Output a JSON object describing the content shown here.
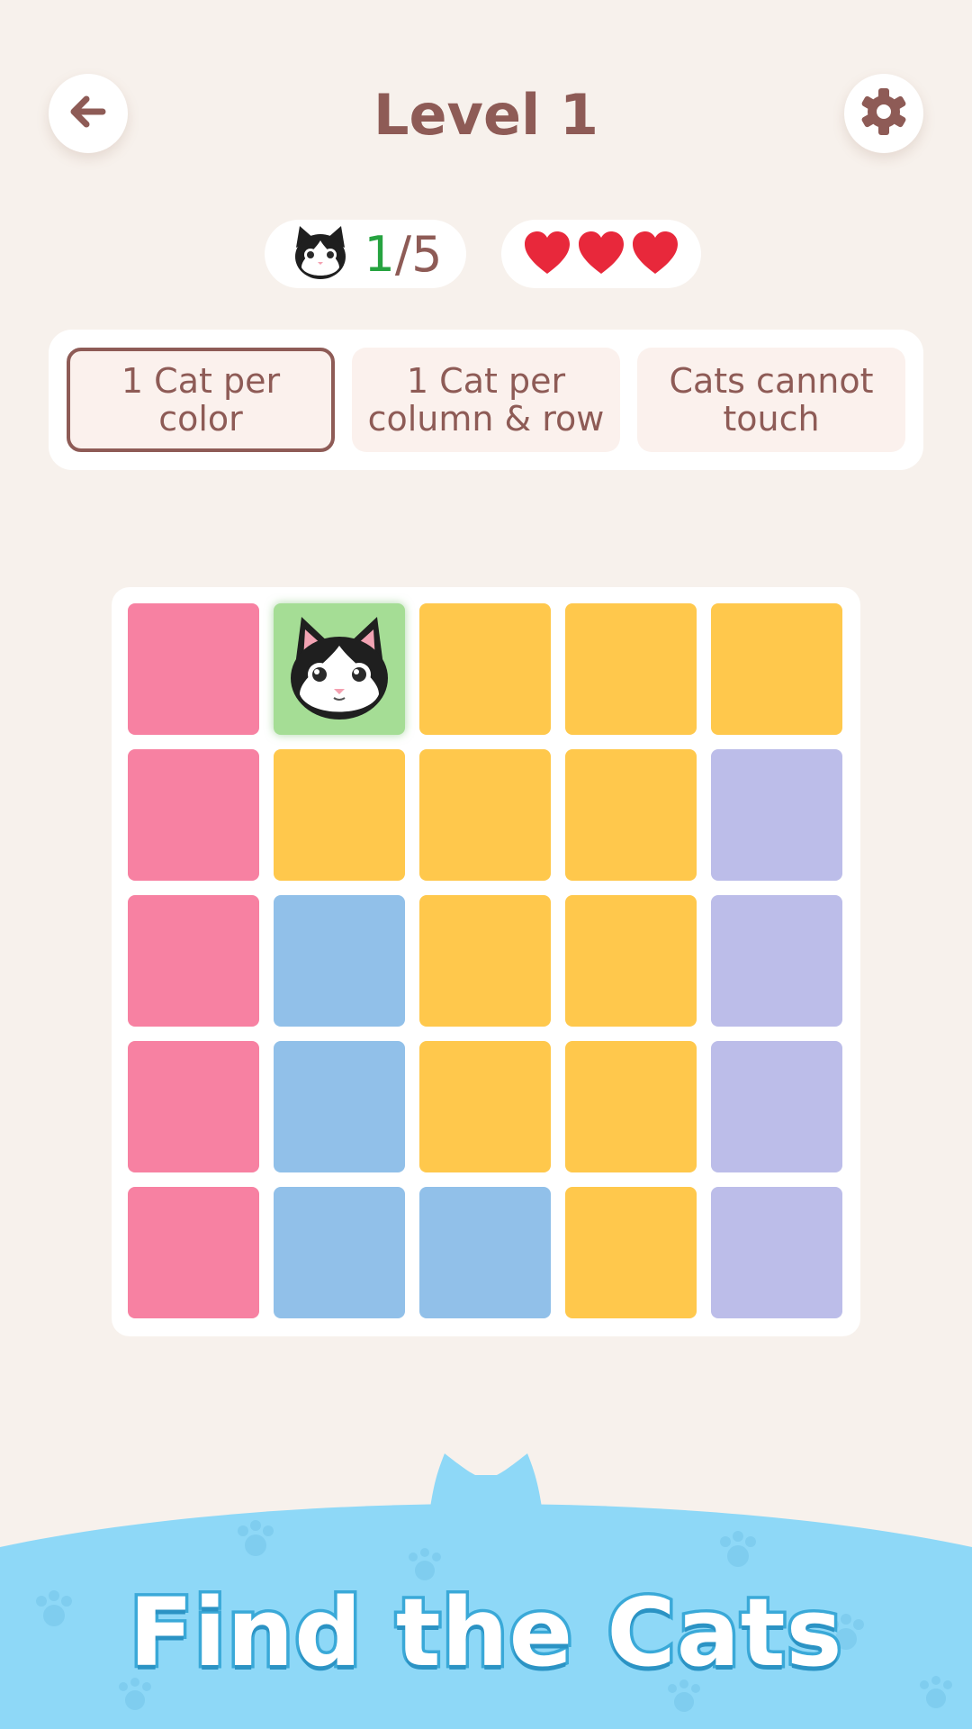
{
  "header": {
    "title": "Level 1",
    "back_icon": "back-arrow-icon",
    "settings_icon": "gear-icon"
  },
  "status": {
    "cats_found": "1",
    "cats_total": "/5",
    "cat_icon": "cat-face-icon",
    "hearts": [
      "❤",
      "❤",
      "❤"
    ]
  },
  "rules": [
    {
      "label": "1 Cat per color",
      "active": true
    },
    {
      "label": "1 Cat per column & row",
      "active": false
    },
    {
      "label": "Cats cannot touch",
      "active": false
    }
  ],
  "board": {
    "colors": {
      "pink": "#f781a2",
      "yellow": "#ffc84c",
      "purple": "#bcbde9",
      "blue": "#91c0e9",
      "found": "#a5dd95"
    },
    "grid": [
      [
        "pink",
        "found",
        "yellow",
        "yellow",
        "yellow"
      ],
      [
        "pink",
        "yellow",
        "yellow",
        "yellow",
        "purple"
      ],
      [
        "pink",
        "blue",
        "yellow",
        "yellow",
        "purple"
      ],
      [
        "pink",
        "blue",
        "yellow",
        "yellow",
        "purple"
      ],
      [
        "pink",
        "blue",
        "blue",
        "yellow",
        "purple"
      ]
    ],
    "cats": [
      [
        0,
        1
      ]
    ]
  },
  "footer": {
    "banner_text": "Find the Cats",
    "accent": "#8ed8f7"
  }
}
